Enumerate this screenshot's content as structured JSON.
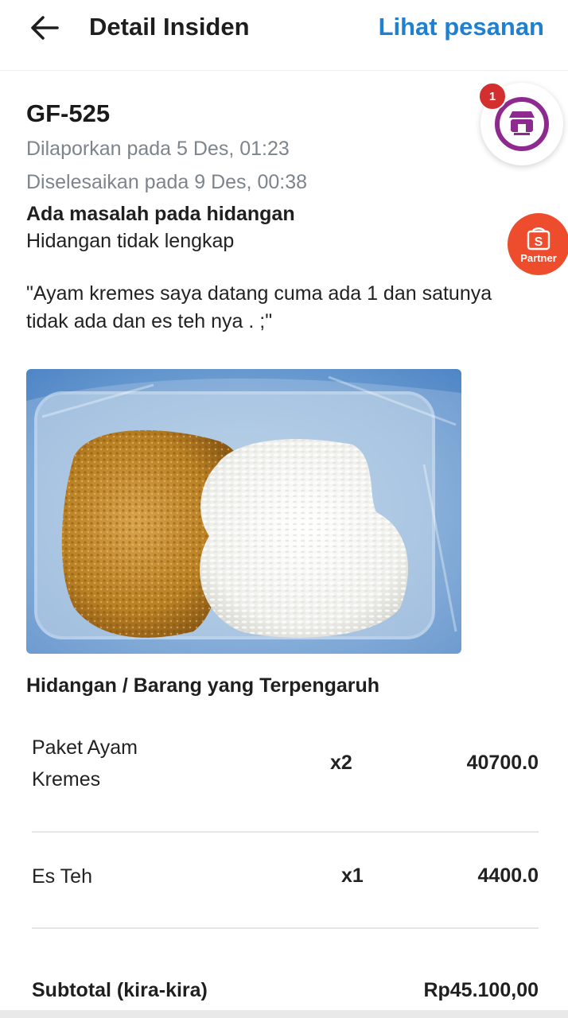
{
  "appbar": {
    "title": "Detail Insiden",
    "view_order_label": "Lihat pesanan"
  },
  "incident": {
    "id": "GF-525",
    "reported": "Dilaporkan pada 5 Des, 01:23",
    "resolved": "Diselesaikan pada 9 Des, 00:38",
    "issue_type": "Ada masalah pada hidangan",
    "issue_detail": "Hidangan tidak lengkap",
    "customer_note": "\"Ayam kremes saya datang cuma ada 1 dan satunya tidak ada dan es teh nya . ;\""
  },
  "affected": {
    "title": "Hidangan / Barang yang Terpengaruh",
    "items": [
      {
        "name": "Paket Ayam Kremes",
        "qty": "x2",
        "price": "40700.0"
      },
      {
        "name": "Es Teh",
        "qty": "x1",
        "price": "4400.0"
      }
    ]
  },
  "subtotal": {
    "label": "Subtotal (kira-kira)",
    "value": "Rp45.100,00"
  },
  "floating": {
    "shop_badge": "1",
    "partner_label": "Partner",
    "partner_letter": "S"
  },
  "colors": {
    "link": "#1f7fd1",
    "meta": "#7d848c",
    "badge": "#d32f2f",
    "partner": "#ee4d2d",
    "shop_icon": "#8e2a8f"
  },
  "icons": [
    "back-arrow-icon",
    "shop-icon",
    "shopee-partner-icon"
  ]
}
